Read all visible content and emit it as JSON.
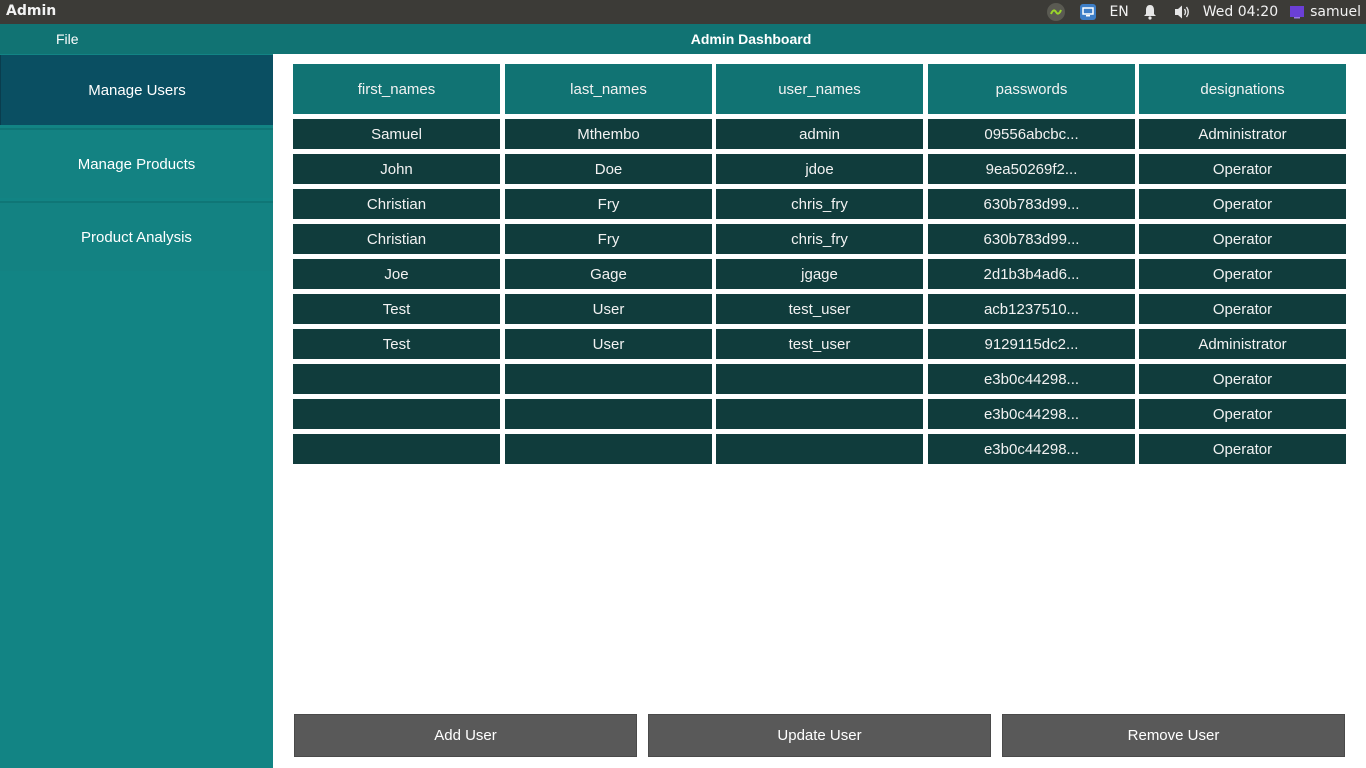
{
  "system": {
    "app_name": "Admin",
    "language": "EN",
    "clock": "Wed 04:20",
    "user": "samuel"
  },
  "app": {
    "menu_file": "File",
    "title": "Admin Dashboard"
  },
  "sidebar": {
    "items": [
      {
        "label": "Manage Users"
      },
      {
        "label": "Manage Products"
      },
      {
        "label": "Product Analysis"
      }
    ]
  },
  "table": {
    "columns": [
      "first_names",
      "last_names",
      "user_names",
      "passwords",
      "designations"
    ],
    "rows": [
      [
        "Samuel",
        "Mthembo",
        "admin",
        "09556abcbc...",
        "Administrator"
      ],
      [
        "John",
        "Doe",
        "jdoe",
        "9ea50269f2...",
        "Operator"
      ],
      [
        "Christian",
        "Fry",
        "chris_fry",
        "630b783d99...",
        "Operator"
      ],
      [
        "Christian",
        "Fry",
        "chris_fry",
        "630b783d99...",
        "Operator"
      ],
      [
        "Joe",
        "Gage",
        "jgage",
        "2d1b3b4ad6...",
        "Operator"
      ],
      [
        "Test",
        "User",
        "test_user",
        "acb1237510...",
        "Operator"
      ],
      [
        "Test",
        "User",
        "test_user",
        "9129115dc2...",
        "Administrator"
      ],
      [
        "",
        "",
        "",
        "e3b0c44298...",
        "Operator"
      ],
      [
        "",
        "",
        "",
        "e3b0c44298...",
        "Operator"
      ],
      [
        "",
        "",
        "",
        "e3b0c44298...",
        "Operator"
      ]
    ]
  },
  "actions": {
    "add": "Add User",
    "update": "Update User",
    "remove": "Remove User"
  }
}
